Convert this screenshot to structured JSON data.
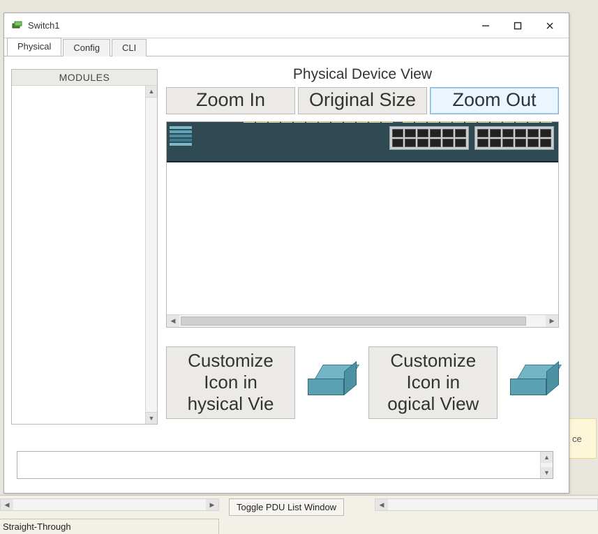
{
  "window": {
    "title": "Switch1",
    "tabs": [
      {
        "label": "Physical",
        "active": true
      },
      {
        "label": "Config",
        "active": false
      },
      {
        "label": "CLI",
        "active": false
      }
    ]
  },
  "modules": {
    "header": "MODULES"
  },
  "view": {
    "heading": "Physical Device View",
    "zoom_in": "Zoom In",
    "original_size": "Original Size",
    "zoom_out": "Zoom Out"
  },
  "customize": {
    "physical": "Customize\nIcon in\nhysical Vie",
    "logical": "Customize\nIcon in\nogical View"
  },
  "bottom": {
    "toggle_pdu": "Toggle PDU List Window",
    "cable_label": "Straight-Through",
    "bg_label": "ce"
  }
}
